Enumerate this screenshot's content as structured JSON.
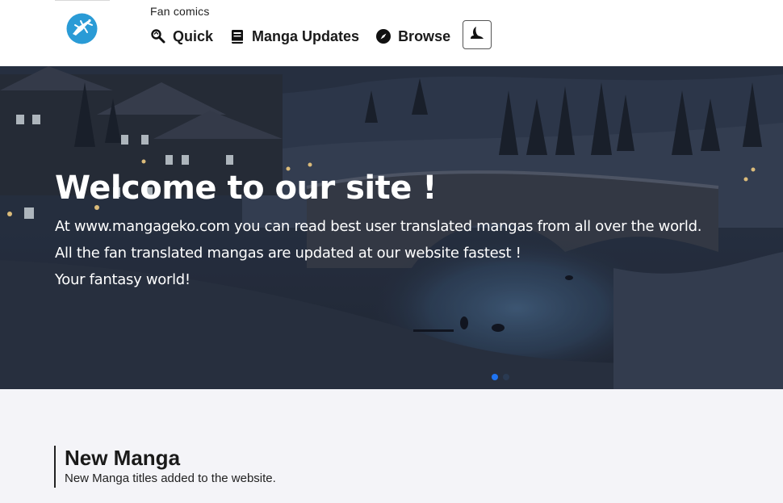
{
  "header": {
    "tagline": "Fan comics",
    "nav": [
      {
        "label": "Quick",
        "icon": "quick-search-icon"
      },
      {
        "label": "Manga Updates",
        "icon": "book-icon"
      },
      {
        "label": "Browse",
        "icon": "compass-icon"
      }
    ],
    "theme_toggle_icon": "moon-icon",
    "logo_icon": "gecko-logo-icon"
  },
  "hero": {
    "title": "Welcome to our site !",
    "lines": [
      "At www.mangageko.com you can read best user translated mangas from all over the world.",
      "All the fan translated mangas are updated at our website fastest !",
      "Your fantasy world!"
    ],
    "slide_index": 1,
    "slide_count": 2
  },
  "section": {
    "title": "New Manga",
    "subtitle": "New Manga titles added to the website."
  },
  "colors": {
    "accent": "#1f74f1",
    "header_bg": "#ffffff",
    "page_bg": "#f4f4f8",
    "logo": "#2a9bd6"
  }
}
